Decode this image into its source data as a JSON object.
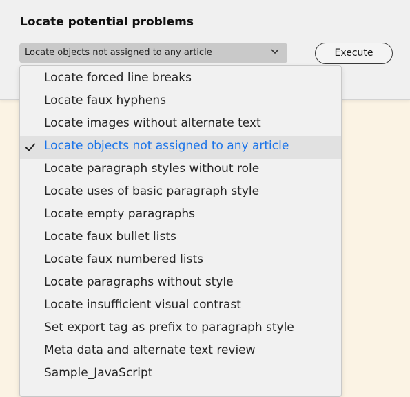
{
  "panel": {
    "title": "Locate potential problems",
    "select_value": "Locate objects not assigned to any article",
    "execute_label": "Execute"
  },
  "menu": {
    "selected_index": 3,
    "accent_color": "#1a73e8",
    "items": [
      {
        "label": "Locate forced line breaks"
      },
      {
        "label": "Locate faux hyphens"
      },
      {
        "label": "Locate images without alternate text"
      },
      {
        "label": "Locate objects not assigned to any article"
      },
      {
        "label": "Locate paragraph styles without role"
      },
      {
        "label": "Locate uses of basic paragraph style"
      },
      {
        "label": "Locate empty paragraphs"
      },
      {
        "label": "Locate faux bullet lists"
      },
      {
        "label": "Locate faux numbered lists"
      },
      {
        "label": "Locate paragraphs without style"
      },
      {
        "label": "Locate insufficient visual contrast"
      },
      {
        "label": "Set export tag as prefix to paragraph style"
      },
      {
        "label": "Meta data and alternate text review"
      },
      {
        "label": "Sample_JavaScript"
      }
    ]
  }
}
